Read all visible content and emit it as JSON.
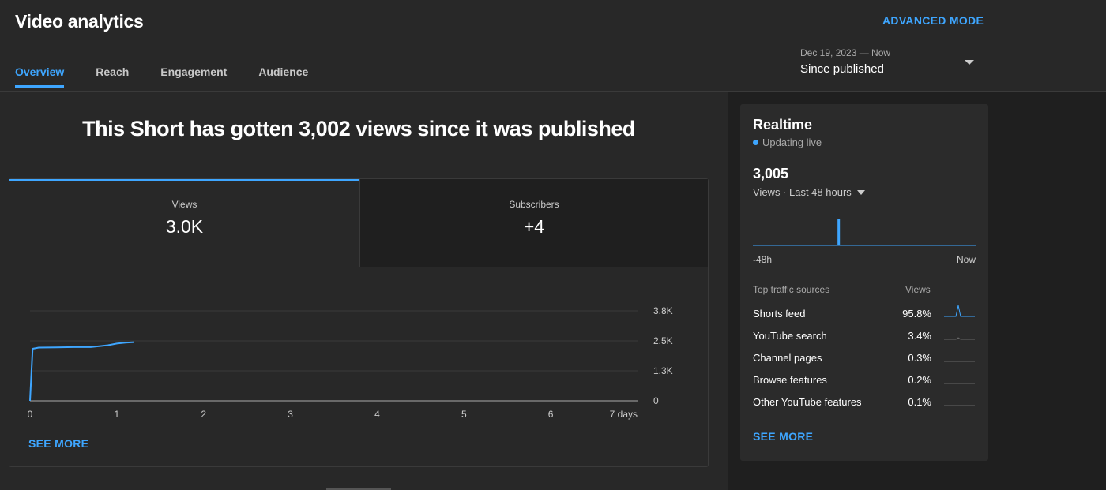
{
  "header": {
    "title": "Video analytics",
    "advanced_mode": "ADVANCED MODE",
    "tabs": [
      "Overview",
      "Reach",
      "Engagement",
      "Audience"
    ],
    "date_range": "Dec 19, 2023 — Now",
    "date_selection": "Since published"
  },
  "main": {
    "headline": "This Short has gotten 3,002 views since it was published",
    "metric_tabs": [
      {
        "label": "Views",
        "value": "3.0K"
      },
      {
        "label": "Subscribers",
        "value": "+4"
      }
    ],
    "see_more": "SEE MORE"
  },
  "chart_data": {
    "type": "line",
    "series": [
      {
        "x": [
          0,
          0.03,
          0.1,
          0.3,
          0.5,
          0.7,
          0.9,
          1.0,
          1.1,
          1.2
        ],
        "y": [
          0,
          2200,
          2250,
          2260,
          2270,
          2270,
          2350,
          2420,
          2460,
          2480
        ]
      }
    ],
    "xticks": [
      "0",
      "1",
      "2",
      "3",
      "4",
      "5",
      "6",
      "7 days"
    ],
    "xlim": [
      0,
      7
    ],
    "yticks": [
      "0",
      "1.3K",
      "2.5K",
      "3.8K"
    ],
    "ylim": [
      0,
      3800
    ],
    "grid": true,
    "color": "#3ea6ff"
  },
  "realtime": {
    "title": "Realtime",
    "status": "Updating live",
    "count": "3,005",
    "period": "Views · Last 48 hours",
    "axis_start": "-48h",
    "axis_end": "Now",
    "hist_values": [
      0,
      0,
      0,
      0,
      0,
      0,
      0,
      0,
      0,
      0,
      0,
      0,
      0,
      0,
      0,
      0,
      0,
      0,
      1,
      0,
      0,
      0,
      0,
      0,
      0,
      0,
      0,
      0,
      0,
      0,
      0,
      0,
      0,
      0,
      0,
      0,
      0,
      0,
      0,
      0,
      0,
      0,
      0,
      0,
      0,
      0,
      0,
      0
    ],
    "traffic_header": "Top traffic sources",
    "views_header": "Views",
    "sources": [
      {
        "name": "Shorts feed",
        "pct": "95.8%"
      },
      {
        "name": "YouTube search",
        "pct": "3.4%"
      },
      {
        "name": "Channel pages",
        "pct": "0.3%"
      },
      {
        "name": "Browse features",
        "pct": "0.2%"
      },
      {
        "name": "Other YouTube features",
        "pct": "0.1%"
      }
    ],
    "see_more": "SEE MORE"
  },
  "colors": {
    "accent": "#3ea6ff",
    "bg": "#282828",
    "panel": "#1f1f1f"
  }
}
